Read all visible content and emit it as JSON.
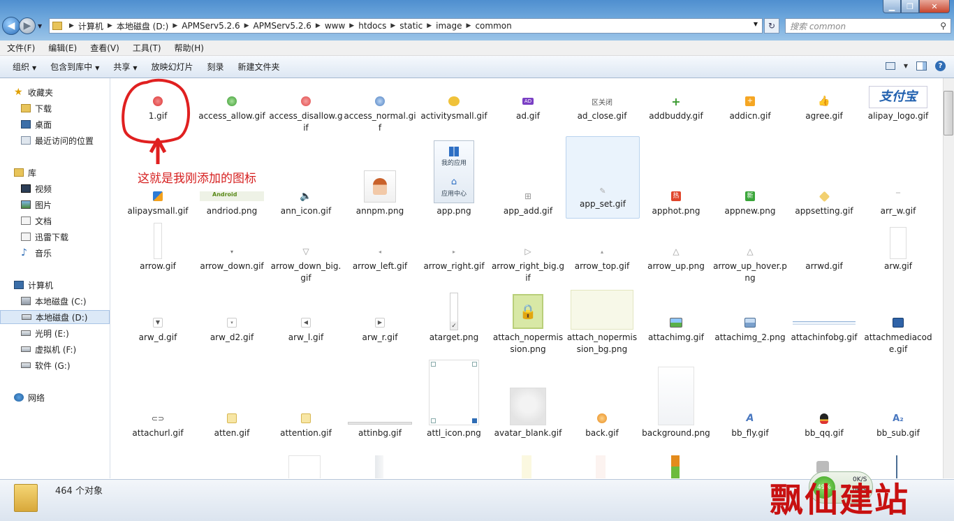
{
  "window": {
    "controls": {
      "minimize": "▁",
      "maximize": "❐",
      "close": "✕"
    }
  },
  "nav": {
    "back_glyph": "◀",
    "forward_glyph": "▶",
    "dropdown_glyph": "▼"
  },
  "address": {
    "crumbs": [
      "计算机",
      "本地磁盘 (D:)",
      "APMServ5.2.6",
      "APMServ5.2.6",
      "www",
      "htdocs",
      "static",
      "image",
      "common"
    ],
    "refresh_glyph": "↻"
  },
  "search": {
    "placeholder": "搜索 common",
    "icon": "search-icon",
    "glyph": "⚲"
  },
  "menu": [
    "文件(F)",
    "编辑(E)",
    "查看(V)",
    "工具(T)",
    "帮助(H)"
  ],
  "toolbar": {
    "organize": "组织",
    "include": "包含到库中",
    "share": "共享",
    "slideshow": "放映幻灯片",
    "burn": "刻录",
    "new_folder": "新建文件夹",
    "dropdown_glyph": "▼",
    "right_icons": [
      "view-icon",
      "preview-pane-icon",
      "help-icon"
    ],
    "help_glyph": "?"
  },
  "sidebar": {
    "favorites": {
      "label": "收藏夹",
      "items": [
        "下载",
        "桌面",
        "最近访问的位置"
      ]
    },
    "libraries": {
      "label": "库",
      "items": [
        "视频",
        "图片",
        "文档",
        "迅雷下载",
        "音乐"
      ]
    },
    "computer": {
      "label": "计算机",
      "items": [
        "本地磁盘 (C:)",
        "本地磁盘 (D:)",
        "光明 (E:)",
        "虚拟机 (F:)",
        "软件 (G:)"
      ]
    },
    "network": {
      "label": "网络"
    },
    "selected": "本地磁盘 (D:)"
  },
  "files": {
    "rows": [
      [
        "1.gif",
        "access_allow.gif",
        "access_disallow.gif",
        "access_normal.gif",
        "activitysmall.gif",
        "ad.gif",
        "ad_close.gif",
        "addbuddy.gif",
        "addicn.gif",
        "agree.gif",
        "alipay_logo.gif"
      ],
      [
        "alipaysmall.gif",
        "andriod.png",
        "ann_icon.gif",
        "annpm.png",
        "app.png",
        "app_add.gif",
        "app_set.gif",
        "apphot.png",
        "appnew.png",
        "appsetting.gif",
        "arr_w.gif"
      ],
      [
        "arrow.gif",
        "arrow_down.gif",
        "arrow_down_big.gif",
        "arrow_left.gif",
        "arrow_right.gif",
        "arrow_right_big.gif",
        "arrow_top.gif",
        "arrow_up.png",
        "arrow_up_hover.png",
        "arrwd.gif",
        "arw.gif"
      ],
      [
        "arw_d.gif",
        "arw_d2.gif",
        "arw_l.gif",
        "arw_r.gif",
        "atarget.png",
        "attach_nopermission.png",
        "attach_nopermission_bg.png",
        "attachimg.gif",
        "attachimg_2.png",
        "attachinfobg.gif",
        "attachmediacode.gif"
      ],
      [
        "attachurl.gif",
        "atten.gif",
        "attention.gif",
        "attinbg.gif",
        "attl_icon.png",
        "avatar_blank.gif",
        "back.gif",
        "background.png",
        "bb_fly.gif",
        "bb_qq.gif",
        "bb_sub.gif"
      ]
    ],
    "selected": "app_set.gif",
    "thumb_text": {
      "ad": "AD",
      "ad_close": "区关闭",
      "alipay_logo": "支付宝",
      "android": "Android",
      "app_icon1": "我的应用",
      "app_icon2": "应用中心",
      "apphot": "热",
      "appnew": "新",
      "bb_fly": "A",
      "bb_sub": "A₂"
    }
  },
  "status": {
    "count": "464 个对象"
  },
  "annotation": {
    "text": "这就是我刚添加的图标"
  },
  "net_meter": {
    "percent": "49%",
    "up": "0K/S",
    "down": "0K/S"
  },
  "watermark": {
    "text": "飘仙建站"
  },
  "colors": {
    "annotation": "#d62020",
    "selection": "#dce9f7",
    "titlebar": "#6ea7dc"
  }
}
